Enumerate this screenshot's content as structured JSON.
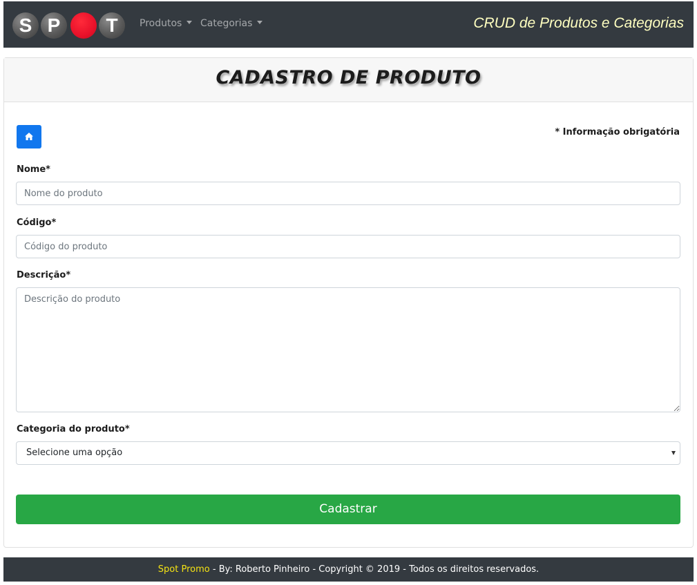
{
  "navbar": {
    "logo_letters": [
      "S",
      "P",
      "",
      "T"
    ],
    "menu": [
      {
        "label": "Produtos"
      },
      {
        "label": "Categorias"
      }
    ],
    "app_title": "CRUD de Produtos e Categorias"
  },
  "card": {
    "title": "CADASTRO DE PRODUTO",
    "home_icon": "home-icon",
    "required_note": "* Informação obrigatória",
    "fields": {
      "nome": {
        "label": "Nome*",
        "placeholder": "Nome do produto",
        "value": ""
      },
      "codigo": {
        "label": "Código*",
        "placeholder": "Código do produto",
        "value": ""
      },
      "descricao": {
        "label": "Descrição*",
        "placeholder": "Descrição do produto",
        "value": ""
      },
      "categoria": {
        "label": "Categoria do produto*",
        "selected": "Selecione uma opção"
      }
    },
    "submit_label": "Cadastrar"
  },
  "footer": {
    "brand": "Spot Promo",
    "text": " - By: Roberto Pinheiro - Copyright © 2019 - Todos os direitos reservados."
  },
  "colors": {
    "navbar_bg": "#343a40",
    "primary": "#1177ee",
    "success": "#28a745",
    "logo_red": "#e8112a",
    "footer_brand": "#f5e313",
    "app_title": "#ffffc0"
  }
}
